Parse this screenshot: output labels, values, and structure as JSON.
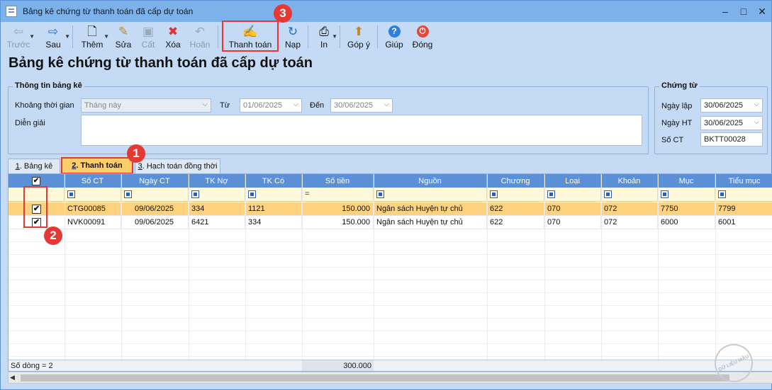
{
  "window": {
    "title": "Bảng kê chứng từ thanh toán đã cấp dự toán"
  },
  "toolbar": {
    "prev": "Trước",
    "next": "Sau",
    "add": "Thêm",
    "edit": "Sửa",
    "save": "Cất",
    "delete": "Xóa",
    "undo": "Hoãn",
    "pay": "Thanh toán",
    "reload": "Nạp",
    "print": "In",
    "feedback": "Góp ý",
    "help": "Giúp",
    "close": "Đóng"
  },
  "page_title": "Bảng kê chứng từ thanh toán đã cấp dự toán",
  "info": {
    "group_title": "Thông tin bảng kê",
    "period_label": "Khoảng thời gian",
    "period_value": "Tháng này",
    "from_label": "Từ",
    "from_value": "01/06/2025",
    "to_label": "Đến",
    "to_value": "30/06/2025",
    "desc_label": "Diễn giải"
  },
  "voucher": {
    "group_title": "Chứng từ",
    "date_label": "Ngày lập",
    "date_value": "30/06/2025",
    "post_label": "Ngày HT",
    "post_value": "30/06/2025",
    "no_label": "Số CT",
    "no_value": "BKTT00028"
  },
  "tabs": {
    "t1_num": "1",
    "t1_text": ". Bảng kê",
    "t2_num": "2",
    "t2_text": ". Thanh toán",
    "t3_num": "3",
    "t3_text": ". Hạch toán đồng thời"
  },
  "grid": {
    "headers": [
      "Số CT",
      "Ngày CT",
      "TK Nợ",
      "TK Có",
      "Số tiền",
      "Nguồn",
      "Chương",
      "Loại",
      "Khoản",
      "Mục",
      "Tiểu mục"
    ],
    "rows": [
      {
        "checked": "✔",
        "so_ct": "CTG00085",
        "ngay_ct": "09/06/2025",
        "tk_no": "334",
        "tk_co": "1121",
        "so_tien": "150.000",
        "nguon": "Ngân sách Huyện tự chủ",
        "chuong": "622",
        "loai": "070",
        "khoan": "072",
        "muc": "7750",
        "tieu_muc": "7799"
      },
      {
        "checked": "✔",
        "so_ct": "NVK00091",
        "ngay_ct": "09/06/2025",
        "tk_no": "6421",
        "tk_co": "334",
        "so_tien": "150.000",
        "nguon": "Ngân sách Huyện tự chủ",
        "chuong": "622",
        "loai": "070",
        "khoan": "072",
        "muc": "6000",
        "tieu_muc": "6001"
      }
    ],
    "footer_count": "Số dòng = 2",
    "footer_total": "300.000"
  },
  "markers": {
    "m1": "1",
    "m2": "2",
    "m3": "3"
  },
  "watermark": "DỮ LIỆU MẪU",
  "colors": {
    "header": "#5b8fd6",
    "selected_row": "#ffd27f",
    "marker": "#e53935",
    "background": "#c4daf5"
  }
}
